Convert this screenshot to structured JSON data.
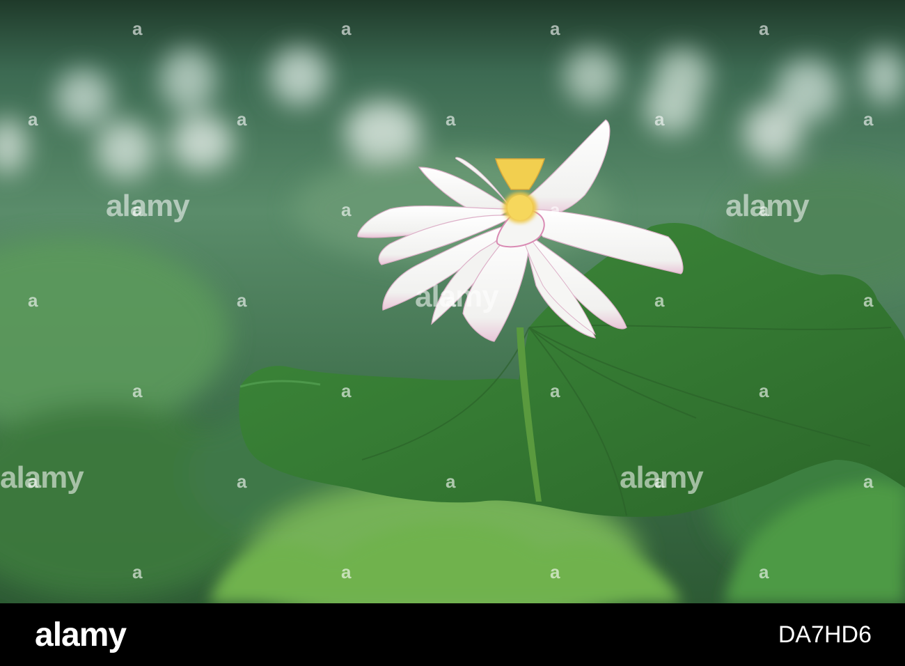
{
  "image": {
    "subject": "white lotus flower with large green lotus leaves",
    "palette": {
      "leaf_dark": "#2f6a2f",
      "leaf_mid": "#3f8a3f",
      "leaf_light": "#7fbf5f",
      "background": "#4a7a5a",
      "petal": "#fafafa",
      "petal_tip": "#d98ab3",
      "receptacle": "#f2cf4f"
    }
  },
  "watermark": {
    "word": "alamy",
    "dot": "a"
  },
  "footer": {
    "logo": "alamy",
    "image_id": "DA7HD6",
    "background": "#000000"
  }
}
